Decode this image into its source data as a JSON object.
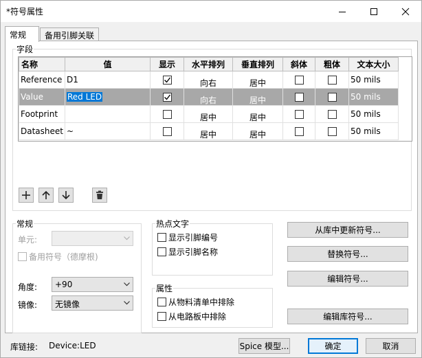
{
  "window": {
    "title": "*符号属性"
  },
  "tabs": [
    {
      "label": "常规"
    },
    {
      "label": "备用引脚关联"
    }
  ],
  "fields_group": {
    "label": "字段"
  },
  "grid": {
    "columns": [
      "名称",
      "值",
      "显示",
      "水平排列",
      "垂直排列",
      "斜体",
      "粗体",
      "文本大小"
    ],
    "rows": [
      {
        "name": "Reference",
        "value": "D1",
        "show": true,
        "h_align": "向右",
        "v_align": "居中",
        "italic": false,
        "bold": false,
        "size": "50 mils",
        "selected": false
      },
      {
        "name": "Value",
        "value": "Red LED",
        "show": true,
        "h_align": "向右",
        "v_align": "居中",
        "italic": false,
        "bold": false,
        "size": "50 mils",
        "selected": true
      },
      {
        "name": "Footprint",
        "value": "",
        "show": false,
        "h_align": "居中",
        "v_align": "居中",
        "italic": false,
        "bold": false,
        "size": "50 mils",
        "selected": false
      },
      {
        "name": "Datasheet",
        "value": "~",
        "show": false,
        "h_align": "居中",
        "v_align": "居中",
        "italic": false,
        "bold": false,
        "size": "50 mils",
        "selected": false
      }
    ]
  },
  "general": {
    "label": "常规",
    "unit_label": "单元:",
    "unit_value": "",
    "alt_symbol_label": "备用符号（德摩根)",
    "alt_symbol_checked": false,
    "angle_label": "角度:",
    "angle_value": "+90",
    "mirror_label": "镜像:",
    "mirror_value": "无镜像"
  },
  "hotspot": {
    "label": "热点文字",
    "show_pin_number": "显示引脚编号",
    "show_pin_number_checked": false,
    "show_pin_name": "显示引脚名称",
    "show_pin_name_checked": false
  },
  "attributes": {
    "label": "属性",
    "exclude_bom": "从物料清单中排除",
    "exclude_bom_checked": false,
    "exclude_board": "从电路板中排除",
    "exclude_board_checked": false
  },
  "actions": {
    "update_from_lib": "从库中更新符号...",
    "replace": "替换符号...",
    "edit": "编辑符号...",
    "edit_lib": "编辑库符号..."
  },
  "footer": {
    "lib_link_label": "库链接:",
    "lib_link_value": "Device:LED",
    "spice_button": "Spice 模型...",
    "ok_button": "确定",
    "cancel_button": "取消"
  },
  "icons": {
    "add": "plus-icon",
    "up": "arrow-up-icon",
    "down": "arrow-down-icon",
    "delete": "trash-icon",
    "minimize": "minimize-icon",
    "maximize": "maximize-icon",
    "close": "close-icon",
    "check": "checkmark-icon",
    "dropdown": "chevron-down-icon"
  },
  "colors": {
    "selection_accent": "#0078d7",
    "selected_row": "#a8a8a8"
  }
}
